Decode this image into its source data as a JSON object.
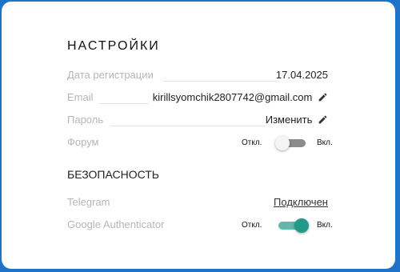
{
  "settings": {
    "title": "НАСТРОЙКИ",
    "registration_label": "Дата регистрации",
    "registration_value": "17.04.2025",
    "email_label": "Email",
    "email_value": "kirillsyomchik2807742@gmail.com",
    "password_label": "Пароль",
    "password_action": "Изменить",
    "forum_label": "Форум",
    "forum_off": "Откл.",
    "forum_on": "Вкл.",
    "forum_enabled": false
  },
  "security": {
    "title": "БЕЗОПАСНОСТЬ",
    "telegram_label": "Telegram",
    "telegram_value": "Подключен",
    "ga_label": "Google Authenticator",
    "ga_off": "Откл.",
    "ga_on": "Вкл.",
    "ga_enabled": true
  },
  "colors": {
    "background": "#1e73c8",
    "accent": "#23998a",
    "muted_label": "#b6b6b6"
  },
  "icons": {
    "edit": "pencil-icon"
  }
}
